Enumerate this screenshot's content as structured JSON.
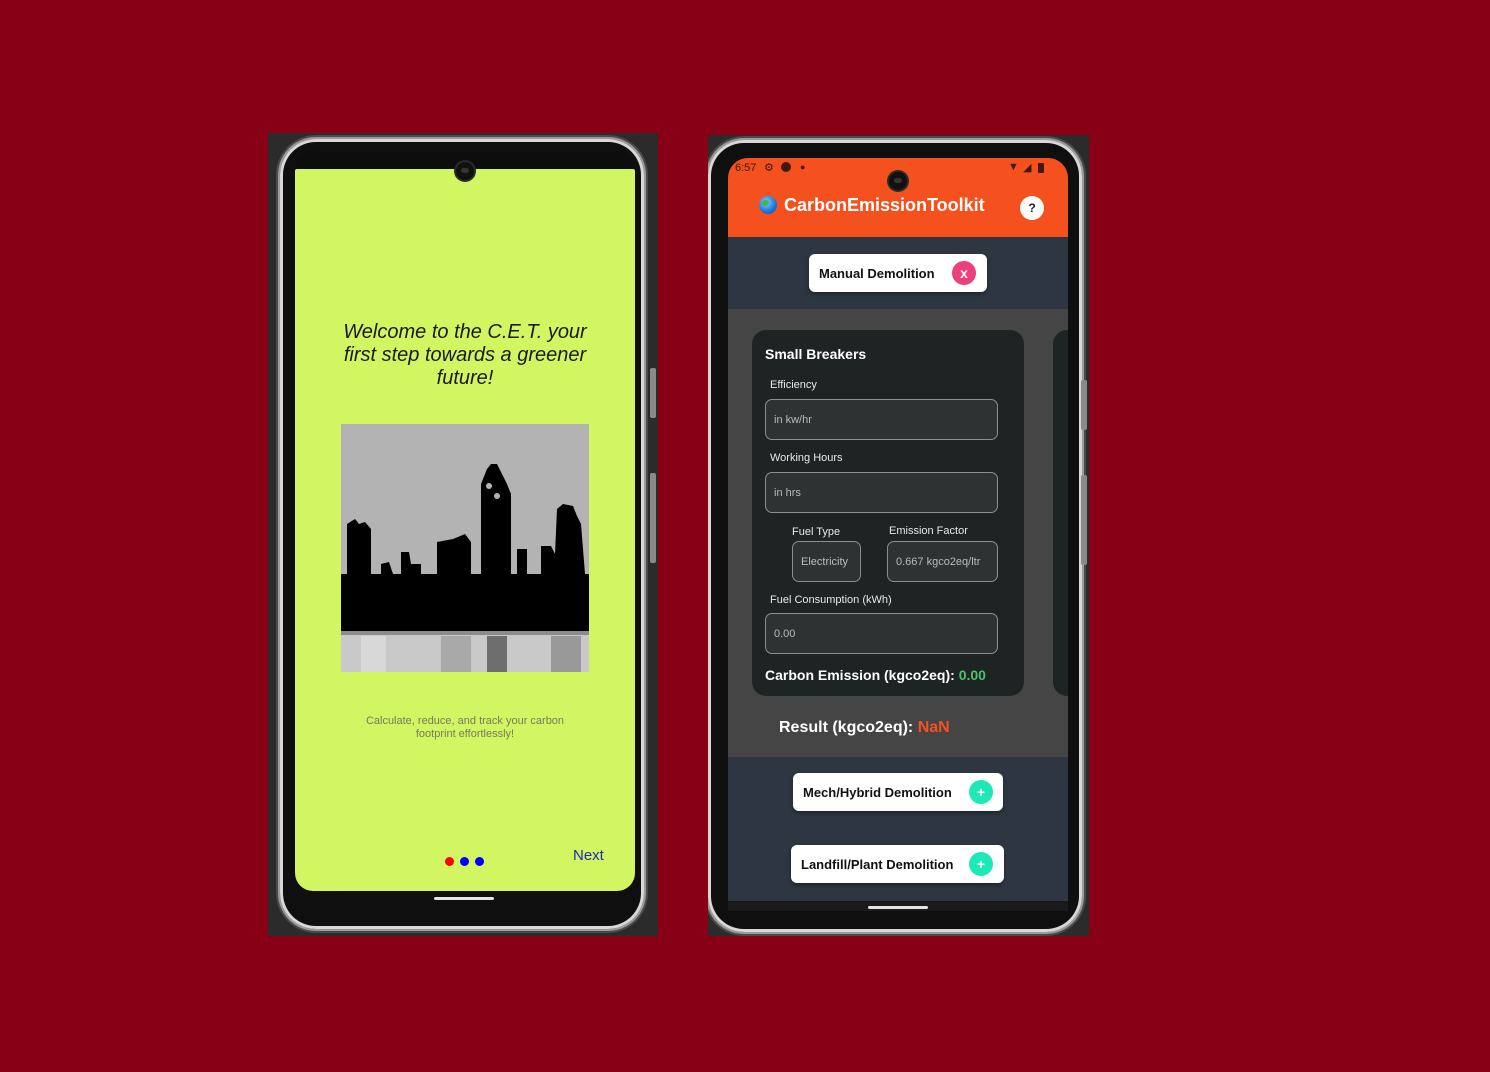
{
  "onboarding": {
    "welcome": "Welcome to the C.E.T. your first step towards a greener future!",
    "tagline": "Calculate, reduce, and track your carbon footprint effortlessly!",
    "next_label": "Next",
    "dot_colors": [
      "#ff0000",
      "#0000ff",
      "#0000ff"
    ]
  },
  "toolkit": {
    "status": {
      "time": "6:57",
      "icons": [
        "gear-icon",
        "a-icon",
        "dot-icon"
      ],
      "right_icons": [
        "wifi-icon",
        "signal-icon",
        "battery-icon"
      ]
    },
    "app_title": "CarbonEmissionToolkit",
    "help_label": "?",
    "manual": {
      "label": "Manual Demolition",
      "close": "x"
    },
    "card": {
      "title": "Small Breakers",
      "efficiency_label": "Efficiency",
      "efficiency_placeholder": "in kw/hr",
      "hours_label": "Working Hours",
      "hours_placeholder": "in hrs",
      "fuel_type_label": "Fuel Type",
      "fuel_type_value": "Electricity",
      "factor_label": "Emission Factor",
      "factor_value": "0.667 kgco2eq/ltr",
      "consumption_label": "Fuel Consumption (kWh)",
      "consumption_value": "0.00",
      "emission_label": "Carbon Emission (kgco2eq):",
      "emission_value": "0.00"
    },
    "result_label": "Result (kgco2eq):",
    "result_value": "NaN",
    "mech": {
      "label": "Mech/Hybrid Demolition",
      "add": "+"
    },
    "landfill": {
      "label": "Landfill/Plant Demolition",
      "add": "+"
    },
    "colors": {
      "accent": "#f4511e",
      "add": "#1de9b6",
      "close": "#ec407a",
      "emission": "#4cc26a"
    }
  }
}
